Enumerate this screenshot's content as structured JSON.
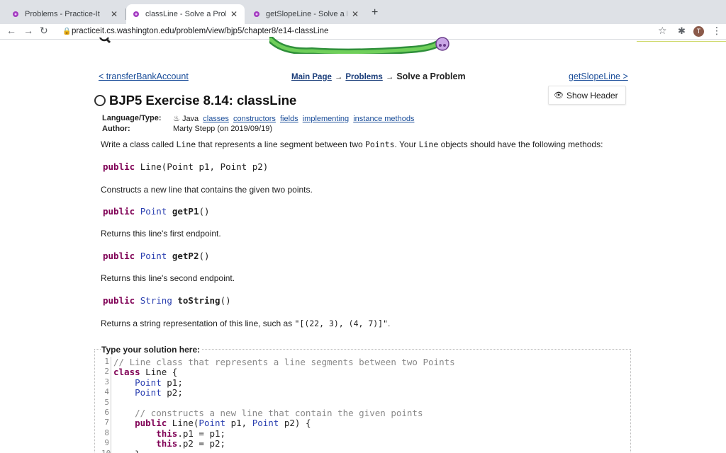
{
  "browser": {
    "tabs": [
      {
        "title": "Problems - Practice-It",
        "active": false
      },
      {
        "title": "classLine - Solve a Problem - P",
        "active": true
      },
      {
        "title": "getSlopeLine - Solve a Problem",
        "active": false
      }
    ],
    "url": "practiceit.cs.washington.edu/problem/view/bjp5/chapter8/e14-classLine",
    "profile_initial": "T"
  },
  "nav": {
    "prev_link": "< transferBankAccount",
    "next_link": "getSlopeLine >",
    "breadcrumb": {
      "main": "Main Page",
      "problems": "Problems",
      "current": "Solve a Problem",
      "arrow": "→"
    }
  },
  "show_header_label": "Show Header",
  "problem": {
    "title": "BJP5 Exercise 8.14: classLine",
    "language_label": "Language/Type:",
    "language": "Java",
    "tags": [
      "classes",
      "constructors",
      "fields",
      "implementing",
      "instance methods"
    ],
    "author_label": "Author:",
    "author": "Marty Stepp (on 2019/09/19)",
    "intro": {
      "p1": "Write a class called ",
      "c1": "Line",
      "p2": " that represents a line segment between two ",
      "c2": "Points",
      "p3": ". Your ",
      "c3": "Line",
      "p4": " objects should have the following methods:"
    },
    "methods": [
      {
        "kw": "public",
        "type": "",
        "name": "Line",
        "params_text": "(Point p1, Point p2)",
        "desc": "Constructs a new line that contains the given two points."
      },
      {
        "kw": "public",
        "type": "Point",
        "name": "getP1",
        "params_text": "()",
        "desc": "Returns this line's first endpoint."
      },
      {
        "kw": "public",
        "type": "Point",
        "name": "getP2",
        "params_text": "()",
        "desc": "Returns this line's second endpoint."
      },
      {
        "kw": "public",
        "type": "String",
        "name": "toString",
        "params_text": "()",
        "desc": "Returns a string representation of this line, such as"
      }
    ],
    "tostring_example": "\"[(22, 3), (4, 7)]\"",
    "tostring_end": "."
  },
  "solution": {
    "label": "Type your solution here:",
    "lines": [
      {
        "n": "1",
        "text": "// Line class that represents a line segments between two Points"
      },
      {
        "n": "2",
        "text": "class Line {"
      },
      {
        "n": "3",
        "text": "    Point p1;"
      },
      {
        "n": "4",
        "text": "    Point p2;"
      },
      {
        "n": "5",
        "text": ""
      },
      {
        "n": "6",
        "text": "    // constructs a new line that contain the given points"
      },
      {
        "n": "7",
        "text": "    public Line(Point p1, Point p2) {"
      },
      {
        "n": "8",
        "text": "        this.p1 = p1;"
      },
      {
        "n": "9",
        "text": "        this.p2 = p2;"
      },
      {
        "n": "10",
        "text": "    }"
      }
    ]
  }
}
